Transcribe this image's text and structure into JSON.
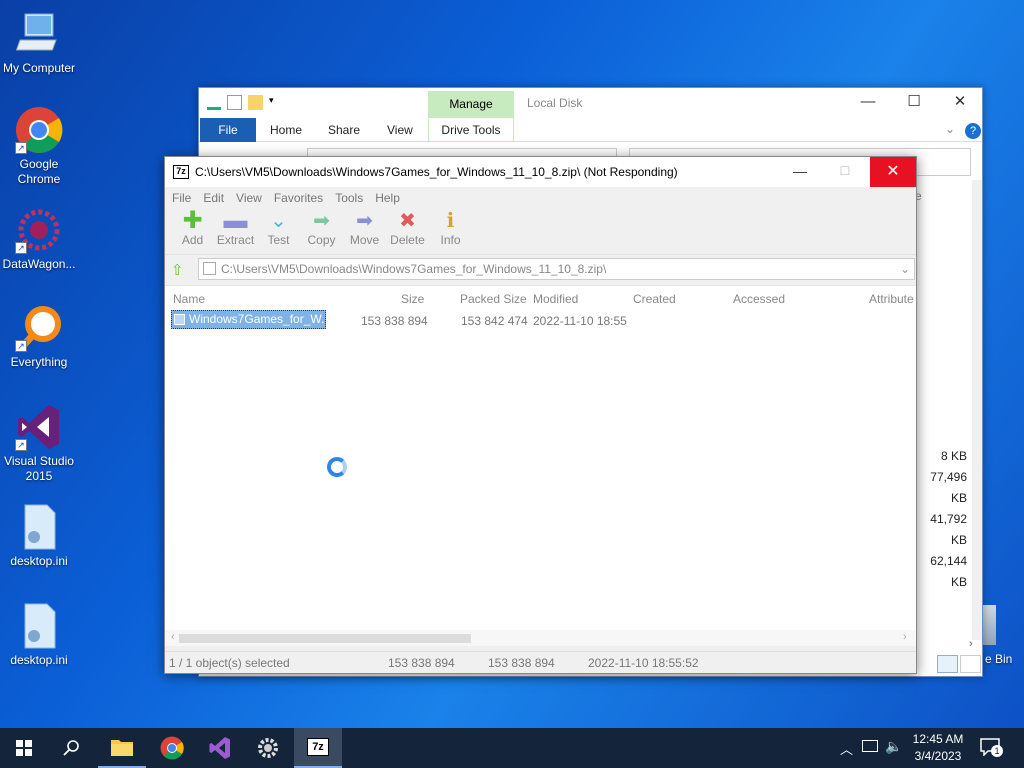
{
  "desktop": {
    "icons": [
      {
        "label": "My Computer"
      },
      {
        "label": "Google Chrome"
      },
      {
        "label": "DataWagon..."
      },
      {
        "label": "Everything"
      },
      {
        "label": "Visual Studio 2015"
      },
      {
        "label": "desktop.ini"
      },
      {
        "label": "desktop.ini"
      }
    ],
    "recycle_bin_label_partial": "e Bin"
  },
  "explorer": {
    "title": "Local Disk",
    "context_tab": "Manage",
    "tabs": {
      "file": "File",
      "home": "Home",
      "share": "Share",
      "view": "View",
      "drive_tools": "Drive Tools"
    },
    "partial_header": "e",
    "visible_sizes": [
      "8 KB",
      "77,496 KB",
      "41,792 KB",
      "62,144 KB"
    ]
  },
  "zip": {
    "title": "C:\\Users\\VM5\\Downloads\\Windows7Games_for_Windows_11_10_8.zip\\ (Not Responding)",
    "menu": [
      "File",
      "Edit",
      "View",
      "Favorites",
      "Tools",
      "Help"
    ],
    "toolbar": {
      "add": "Add",
      "extract": "Extract",
      "test": "Test",
      "copy": "Copy",
      "move": "Move",
      "delete": "Delete",
      "info": "Info"
    },
    "address": "C:\\Users\\VM5\\Downloads\\Windows7Games_for_Windows_11_10_8.zip\\",
    "columns": {
      "name": "Name",
      "size": "Size",
      "packed_size": "Packed Size",
      "modified": "Modified",
      "created": "Created",
      "accessed": "Accessed",
      "attributes": "Attribute"
    },
    "rows": [
      {
        "name": "Windows7Games_for_W...",
        "size": "153 838 894",
        "packed_size": "153 842 474",
        "modified": "2022-11-10 18:55"
      }
    ],
    "status": {
      "selection": "1 / 1 object(s) selected",
      "size": "153 838 894",
      "packed": "153 838 894",
      "modified": "2022-11-10 18:55:52"
    }
  },
  "taskbar": {
    "time": "12:45 AM",
    "date": "3/4/2023",
    "notification_count": "1"
  },
  "colors": {
    "close_red": "#e81123",
    "manage_green": "#c7eabf",
    "selection_blue": "#7fb3e6",
    "taskbar": "#14253b"
  }
}
